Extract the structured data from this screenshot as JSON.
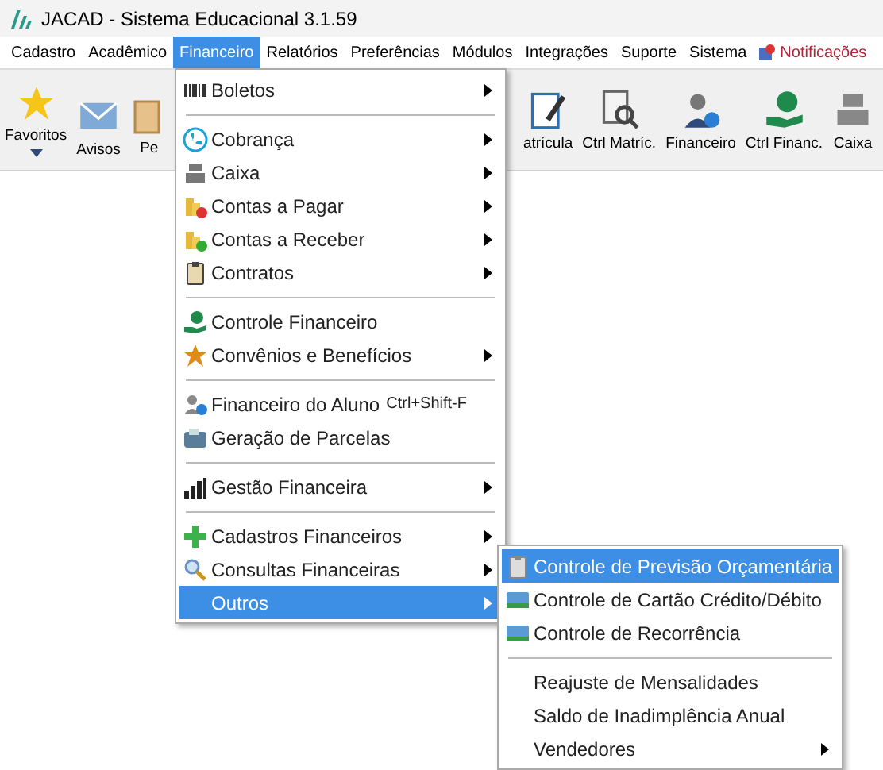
{
  "window": {
    "title": "JACAD - Sistema Educacional 3.1.59"
  },
  "menu_bar": [
    {
      "label": "Cadastro",
      "selected": false,
      "kind": "menu"
    },
    {
      "label": "Acadêmico",
      "selected": false,
      "kind": "menu"
    },
    {
      "label": "Financeiro",
      "selected": true,
      "kind": "menu"
    },
    {
      "label": "Relatórios",
      "selected": false,
      "kind": "menu"
    },
    {
      "label": "Preferências",
      "selected": false,
      "kind": "menu"
    },
    {
      "label": "Módulos",
      "selected": false,
      "kind": "menu"
    },
    {
      "label": "Integrações",
      "selected": false,
      "kind": "menu"
    },
    {
      "label": "Suporte",
      "selected": false,
      "kind": "menu"
    },
    {
      "label": "Sistema",
      "selected": false,
      "kind": "menu"
    },
    {
      "label": "Notificações",
      "selected": false,
      "kind": "notification"
    }
  ],
  "toolbar_left": [
    {
      "label": "Favoritos",
      "dropdown": true
    },
    {
      "label": "Avisos",
      "dropdown": false
    },
    {
      "label": "Pe",
      "dropdown": false
    }
  ],
  "toolbar_right": [
    {
      "label": "atrícula"
    },
    {
      "label": "Ctrl Matríc."
    },
    {
      "label": "Financeiro"
    },
    {
      "label": "Ctrl Financ."
    },
    {
      "label": "Caixa"
    }
  ],
  "financeiro_menu": [
    {
      "kind": "item",
      "label": "Boletos",
      "submenu": true,
      "selected": false
    },
    {
      "kind": "separator"
    },
    {
      "kind": "item",
      "label": "Cobrança",
      "submenu": true,
      "selected": false
    },
    {
      "kind": "item",
      "label": "Caixa",
      "submenu": true,
      "selected": false
    },
    {
      "kind": "item",
      "label": "Contas a Pagar",
      "submenu": true,
      "selected": false
    },
    {
      "kind": "item",
      "label": "Contas a Receber",
      "submenu": true,
      "selected": false
    },
    {
      "kind": "item",
      "label": "Contratos",
      "submenu": true,
      "selected": false
    },
    {
      "kind": "separator"
    },
    {
      "kind": "item",
      "label": "Controle Financeiro",
      "submenu": false,
      "selected": false
    },
    {
      "kind": "item",
      "label": "Convênios e Benefícios",
      "submenu": true,
      "selected": false
    },
    {
      "kind": "separator"
    },
    {
      "kind": "item",
      "label": "Financeiro do Aluno",
      "shortcut": "Ctrl+Shift-F",
      "submenu": false,
      "selected": false
    },
    {
      "kind": "item",
      "label": "Geração de Parcelas",
      "submenu": false,
      "selected": false
    },
    {
      "kind": "separator"
    },
    {
      "kind": "item",
      "label": "Gestão Financeira",
      "submenu": true,
      "selected": false
    },
    {
      "kind": "separator"
    },
    {
      "kind": "item",
      "label": "Cadastros Financeiros",
      "submenu": true,
      "selected": false
    },
    {
      "kind": "item",
      "label": "Consultas Financeiras",
      "submenu": true,
      "selected": false
    },
    {
      "kind": "item",
      "label": "Outros",
      "submenu": true,
      "selected": true
    }
  ],
  "outros_submenu": [
    {
      "kind": "item",
      "label": "Controle de Previsão Orçamentária",
      "submenu": false,
      "selected": true
    },
    {
      "kind": "item",
      "label": "Controle de Cartão Crédito/Débito",
      "submenu": false,
      "selected": false
    },
    {
      "kind": "item",
      "label": "Controle de Recorrência",
      "submenu": false,
      "selected": false
    },
    {
      "kind": "separator"
    },
    {
      "kind": "item",
      "label": "Reajuste de Mensalidades",
      "submenu": false,
      "selected": false
    },
    {
      "kind": "item",
      "label": "Saldo de Inadimplência Anual",
      "submenu": false,
      "selected": false
    },
    {
      "kind": "item",
      "label": "Vendedores",
      "submenu": true,
      "selected": false
    }
  ]
}
